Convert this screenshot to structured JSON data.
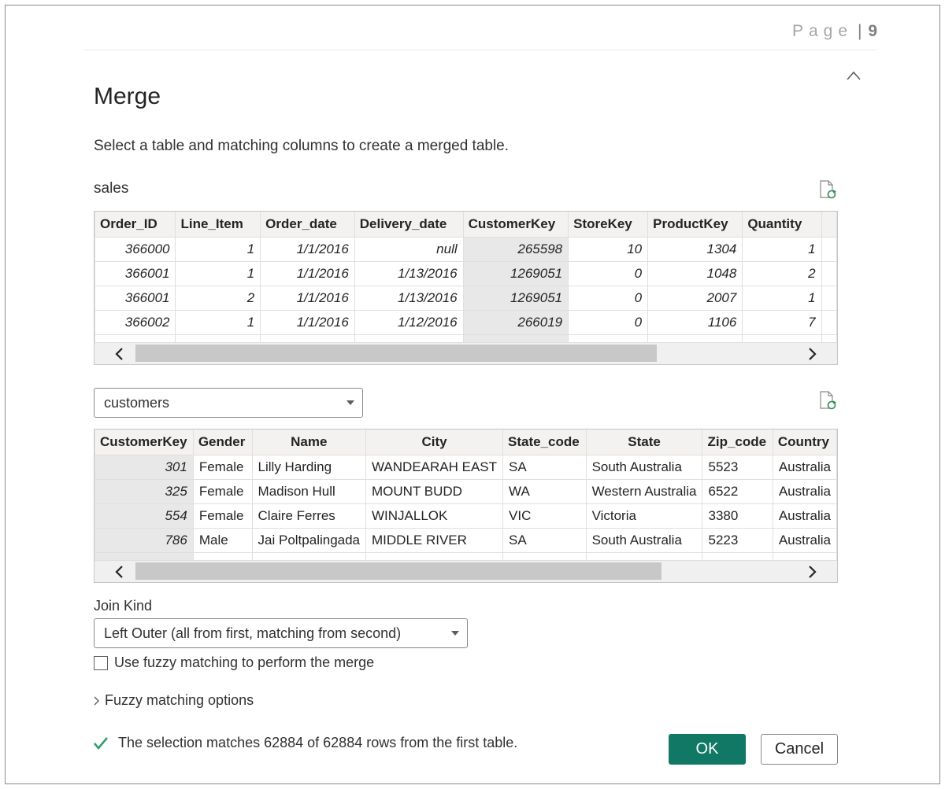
{
  "page_header": {
    "word": "Page",
    "separator": "|",
    "number": "9"
  },
  "dialog": {
    "title": "Merge",
    "subtitle": "Select a table and matching columns to create a merged table."
  },
  "first_table": {
    "name": "sales",
    "columns": [
      "Order_ID",
      "Line_Item",
      "Order_date",
      "Delivery_date",
      "CustomerKey",
      "StoreKey",
      "ProductKey",
      "Quantity"
    ],
    "selected_column": "CustomerKey",
    "rows": [
      [
        "366000",
        "1",
        "1/1/2016",
        "null",
        "265598",
        "10",
        "1304",
        "1"
      ],
      [
        "366001",
        "1",
        "1/1/2016",
        "1/13/2016",
        "1269051",
        "0",
        "1048",
        "2"
      ],
      [
        "366001",
        "2",
        "1/1/2016",
        "1/13/2016",
        "1269051",
        "0",
        "2007",
        "1"
      ],
      [
        "366002",
        "1",
        "1/1/2016",
        "1/12/2016",
        "266019",
        "0",
        "1106",
        "7"
      ]
    ]
  },
  "second_table": {
    "selected_table": "customers",
    "columns": [
      "CustomerKey",
      "Gender",
      "Name",
      "City",
      "State_code",
      "State",
      "Zip_code",
      "Country"
    ],
    "selected_column": "CustomerKey",
    "rows": [
      [
        "301",
        "Female",
        "Lilly Harding",
        "WANDEARAH EAST",
        "SA",
        "South Australia",
        "5523",
        "Australia"
      ],
      [
        "325",
        "Female",
        "Madison Hull",
        "MOUNT BUDD",
        "WA",
        "Western Australia",
        "6522",
        "Australia"
      ],
      [
        "554",
        "Female",
        "Claire Ferres",
        "WINJALLOK",
        "VIC",
        "Victoria",
        "3380",
        "Australia"
      ],
      [
        "786",
        "Male",
        "Jai Poltpalingada",
        "MIDDLE RIVER",
        "SA",
        "South Australia",
        "5223",
        "Australia"
      ]
    ]
  },
  "join": {
    "label": "Join Kind",
    "selected": "Left Outer (all from first, matching from second)"
  },
  "fuzzy": {
    "checkbox_label": "Use fuzzy matching to perform the merge",
    "checked": false,
    "options_label": "Fuzzy matching options"
  },
  "status": {
    "message": "The selection matches 62884 of 62884 rows from the first table.",
    "color": "#107c10"
  },
  "buttons": {
    "ok": "OK",
    "cancel": "Cancel"
  },
  "colors": {
    "accent": "#117865",
    "selected_column": "#e8e8e8"
  },
  "icons": [
    "close-icon",
    "refresh-icon",
    "chevron-left-icon",
    "chevron-right-icon",
    "check-icon"
  ]
}
